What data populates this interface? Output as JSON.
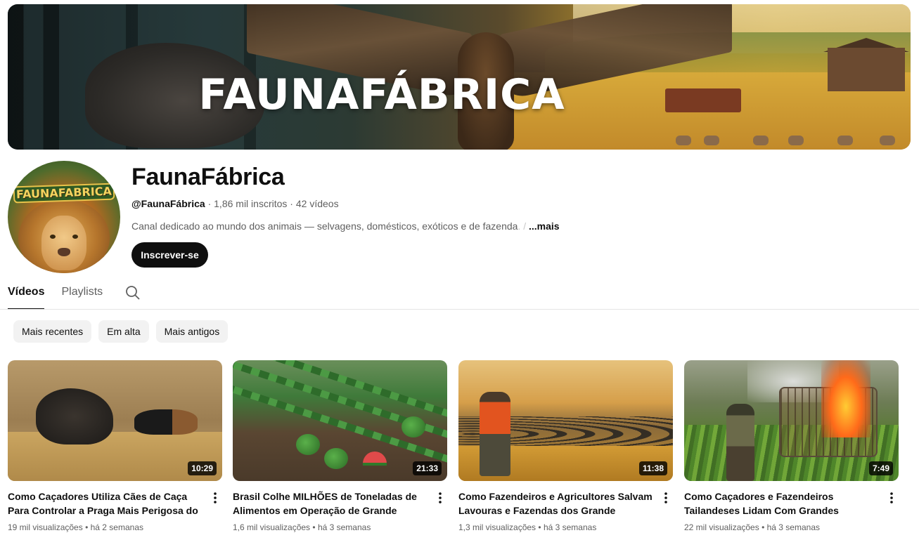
{
  "banner": {
    "title": "FAUNAFÁBRICA"
  },
  "channel": {
    "name": "FaunaFábrica",
    "avatar_text": "FAUNAFABRICA",
    "handle": "@FaunaFábrica",
    "subscribers": "1,86 mil inscritos",
    "video_count": "42 vídeos",
    "separator": "·",
    "description": "Canal dedicado ao mundo dos animais — selvagens, domésticos, exóticos e de fazenda",
    "description_fade": ". /",
    "more_label": "...mais",
    "subscribe_label": "Inscrever-se"
  },
  "tabs": [
    {
      "label": "Vídeos",
      "active": true
    },
    {
      "label": "Playlists",
      "active": false
    }
  ],
  "tabs_search_icon": "search-icon",
  "filters": [
    {
      "label": "Mais recentes"
    },
    {
      "label": "Em alta"
    },
    {
      "label": "Mais antigos"
    }
  ],
  "videos": [
    {
      "title": "Como Caçadores Utiliza Cães de Caça Para Controlar a Praga Mais Perigosa do Brasil",
      "duration": "10:29",
      "views": "19 mil visualizações",
      "age": "há 2 semanas"
    },
    {
      "title": "Brasil Colhe MILHÕES de Toneladas de Alimentos em Operação de Grande Escala",
      "duration": "21:33",
      "views": "1,6 mil visualizações",
      "age": "há 3 semanas"
    },
    {
      "title": "Como Fazendeiros e Agricultores Salvam Lavouras e Fazendas dos Grande Búfalo...",
      "duration": "11:38",
      "views": "1,3 mil visualizações",
      "age": "há 3 semanas"
    },
    {
      "title": "Como Caçadores e Fazendeiros Tailandeses Lidam Com Grandes Babuínos Invasores e...",
      "duration": "7:49",
      "views": "22 mil visualizações",
      "age": "há 3 semanas"
    }
  ],
  "meta_separator": "•",
  "colors": {
    "subscribe_bg": "#0f0f0f",
    "chip_bg": "#f2f2f2",
    "secondary_text": "#606060"
  }
}
